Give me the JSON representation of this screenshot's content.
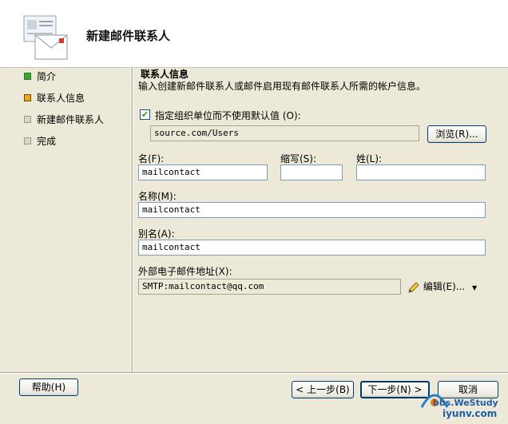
{
  "window": {
    "title": "新建邮件联系人"
  },
  "steps": [
    {
      "label": "简介",
      "state": "done",
      "color": "#3aa630"
    },
    {
      "label": "联系人信息",
      "state": "current",
      "color": "#e8a81a"
    },
    {
      "label": "新建邮件联系人",
      "state": "pending",
      "color": "#d7d4cb"
    },
    {
      "label": "完成",
      "state": "pending",
      "color": "#d7d4cb"
    }
  ],
  "section": {
    "title": "联系人信息",
    "description": "输入创建新邮件联系人或邮件启用现有邮件联系人所需的帐户信息。"
  },
  "ou": {
    "checkbox_label": "指定组织单位而不使用默认值 (O):",
    "checked": true,
    "value": "source.com/Users",
    "browse_label": "浏览(R)..."
  },
  "fields": {
    "first_name": {
      "label": "名(F):",
      "value": "mailcontact"
    },
    "initials": {
      "label": "缩写(S):",
      "value": ""
    },
    "last_name": {
      "label": "姓(L):",
      "value": ""
    },
    "name": {
      "label": "名称(M):",
      "value": "mailcontact"
    },
    "alias": {
      "label": "别名(A):",
      "value": "mailcontact"
    },
    "external_email": {
      "label": "外部电子邮件地址(X):",
      "value": "SMTP:mailcontact@qq.com",
      "edit_label": "编辑(E)...",
      "edit_icon": "pencil-icon"
    }
  },
  "footer": {
    "help_label": "帮助(H)",
    "back_label": "< 上一步(B)",
    "next_label": "下一步(N) >",
    "cancel_label": "取消"
  },
  "watermark": {
    "line1": "bbs.WeStudy",
    "line2": "iyunv.com"
  }
}
